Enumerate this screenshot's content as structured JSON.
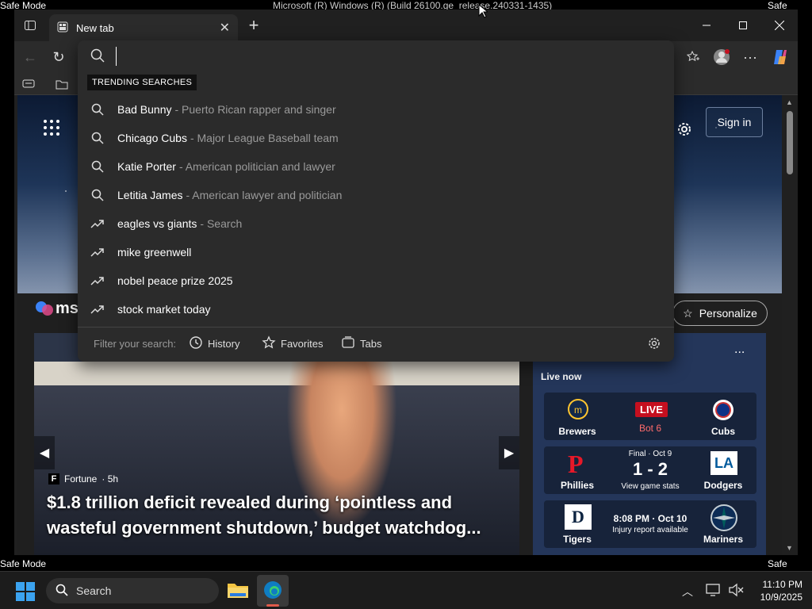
{
  "desktop": {
    "title_bar": "Microsoft (R) Windows (R) (Build 26100.ge_release.240331-1435)",
    "safe_mode": "Safe Mode"
  },
  "browser": {
    "tab_title": "New tab",
    "window_controls": {
      "minimize": "minimize-icon",
      "maximize": "maximize-icon",
      "close": "close-icon"
    }
  },
  "address_bar": {
    "value": "",
    "icon": "search-icon"
  },
  "dropdown": {
    "trending_label": "TRENDING SEARCHES",
    "suggestions": [
      {
        "term": "Bad Bunny",
        "sub": "- Puerto Rican rapper and singer",
        "icon": "search-icon"
      },
      {
        "term": "Chicago Cubs",
        "sub": "- Major League Baseball team",
        "icon": "search-icon"
      },
      {
        "term": "Katie Porter",
        "sub": "- American politician and lawyer",
        "icon": "search-icon"
      },
      {
        "term": "Letitia James",
        "sub": "- American lawyer and politician",
        "icon": "search-icon"
      },
      {
        "term": "eagles vs giants",
        "sub": "- Search",
        "icon": "trending-icon"
      },
      {
        "term": "mike greenwell",
        "sub": "",
        "icon": "trending-icon"
      },
      {
        "term": "nobel peace prize 2025",
        "sub": "",
        "icon": "trending-icon"
      },
      {
        "term": "stock market today",
        "sub": "",
        "icon": "trending-icon"
      }
    ],
    "filter_label": "Filter your search:",
    "filter_history": "History",
    "filter_favorites": "Favorites",
    "filter_tabs": "Tabs"
  },
  "msn": {
    "logo_text": "ms",
    "sign_in": "Sign in",
    "personalize": "Personalize",
    "more": "...",
    "live_now": "Live now"
  },
  "news": {
    "source": "Fortune",
    "age": "· 5h",
    "headline": "$1.8 trillion deficit revealed during ‘pointless and wasteful government shutdown,’ budget watchdog..."
  },
  "sports": [
    {
      "home": "Brewers",
      "away": "Cubs",
      "status": "LIVE",
      "detail": "Bot 6"
    },
    {
      "home": "Phillies",
      "away": "Dodgers",
      "status": "Final · Oct 9",
      "score": "1 - 2",
      "detail": "View game stats"
    },
    {
      "home": "Tigers",
      "away": "Mariners",
      "status": "8:08 PM · Oct 10",
      "detail": "Injury report available"
    }
  ],
  "taskbar": {
    "search_placeholder": "Search",
    "time": "11:10 PM",
    "date": "10/9/2025"
  },
  "colors": {
    "accent": "#0078d4",
    "live_red": "#c50f1f",
    "card_bg": "#17233a"
  }
}
